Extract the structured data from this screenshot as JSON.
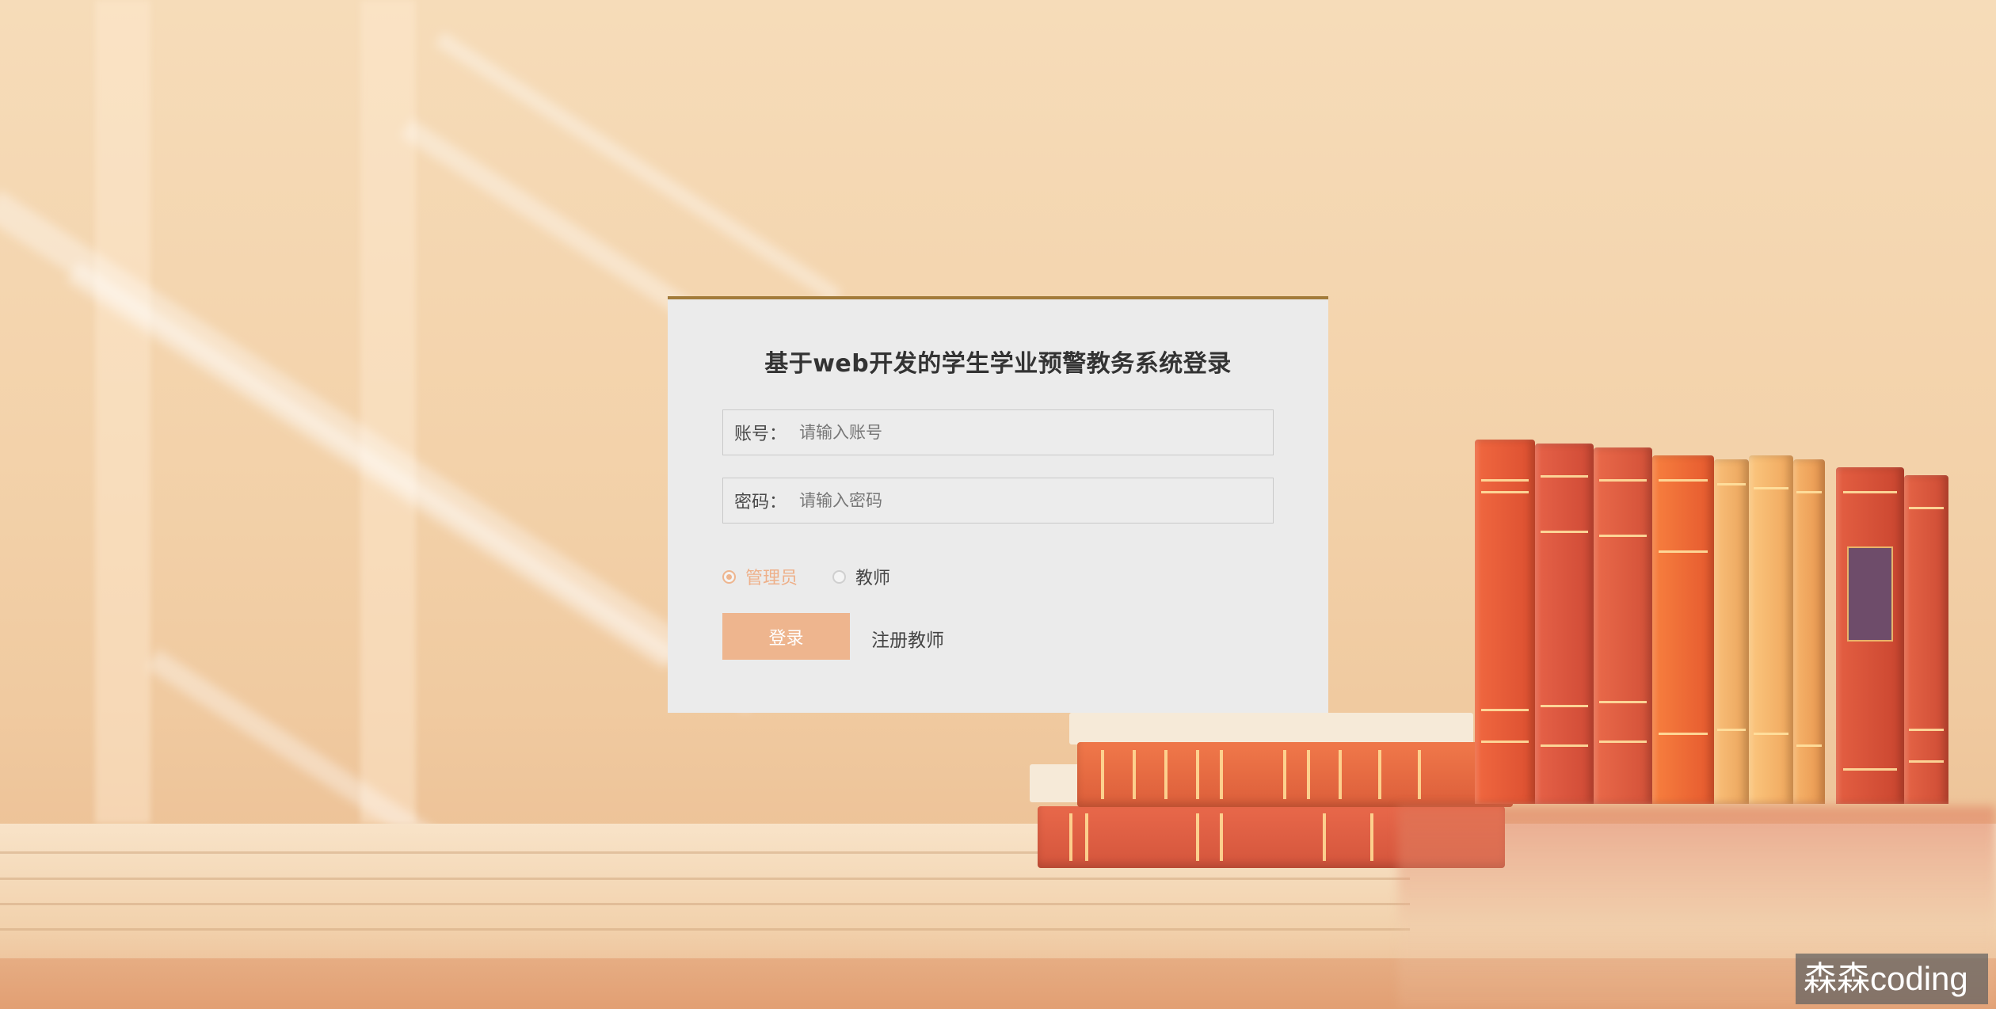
{
  "login": {
    "title": "基于web开发的学生学业预警教务系统登录",
    "account_label": "账号：",
    "account_placeholder": "请输入账号",
    "account_value": "",
    "password_label": "密码：",
    "password_placeholder": "请输入密码",
    "password_value": "",
    "roles": [
      {
        "label": "管理员",
        "selected": true
      },
      {
        "label": "教师",
        "selected": false
      }
    ],
    "login_button": "登录",
    "register_link": "注册教师"
  },
  "watermark": "森森coding",
  "colors": {
    "accent": "#eeb58e",
    "card_border": "#a27b3a",
    "card_bg": "#ebebeb",
    "title": "#333333"
  }
}
